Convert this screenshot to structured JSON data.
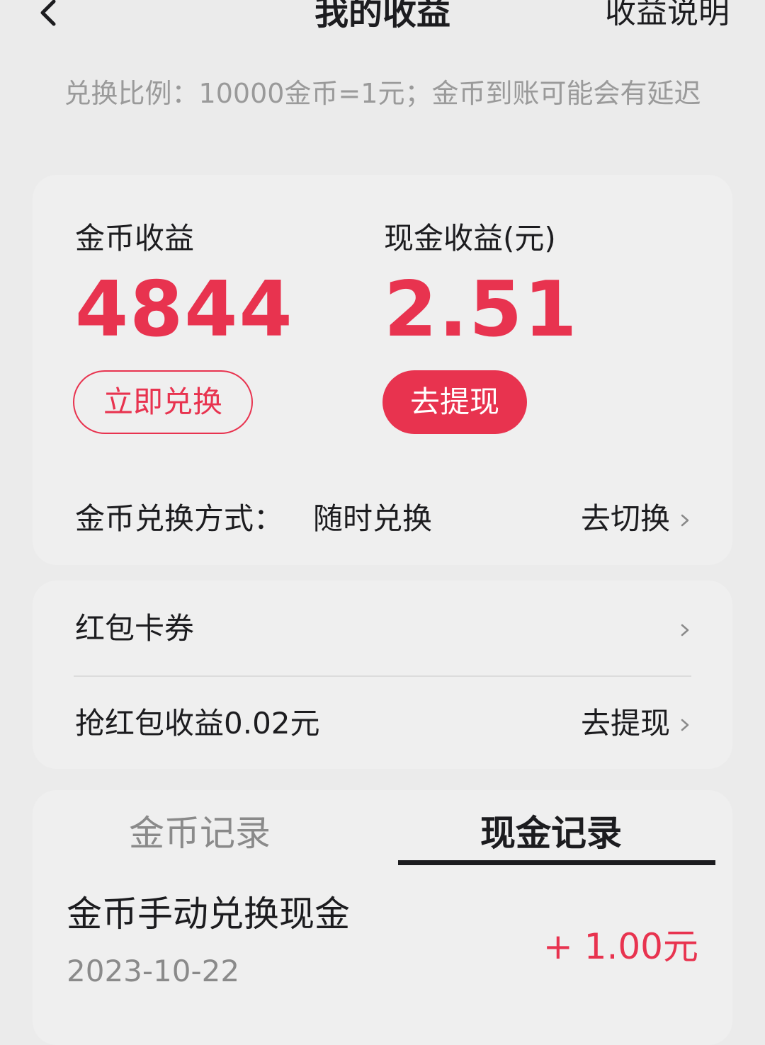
{
  "header": {
    "title": "我的收益",
    "explain_link": "收益说明"
  },
  "notice": "兑换比例：10000金币=1元；金币到账可能会有延迟",
  "earnings": {
    "coin_label": "金币收益",
    "coin_value": "4844",
    "cash_label": "现金收益(元)",
    "cash_value": "2.51",
    "exchange_button": "立即兑换",
    "withdraw_button": "去提现",
    "exchange_mode_label": "金币兑换方式：",
    "exchange_mode_value": "随时兑换",
    "switch_action": "去切换"
  },
  "links": {
    "coupons_label": "红包卡券",
    "grab_label": "抢红包收益0.02元",
    "grab_action": "去提现"
  },
  "records": {
    "tabs": [
      "金币记录",
      "现金记录"
    ],
    "active_tab": "现金记录",
    "items": [
      {
        "title": "金币手动兑换现金",
        "date": "2023-10-22",
        "amount": "+ 1.00元"
      }
    ]
  },
  "colors": {
    "accent": "#e8334f",
    "background": "#ebebeb",
    "text": "#1c1c1f",
    "muted": "#9a9a9a"
  }
}
